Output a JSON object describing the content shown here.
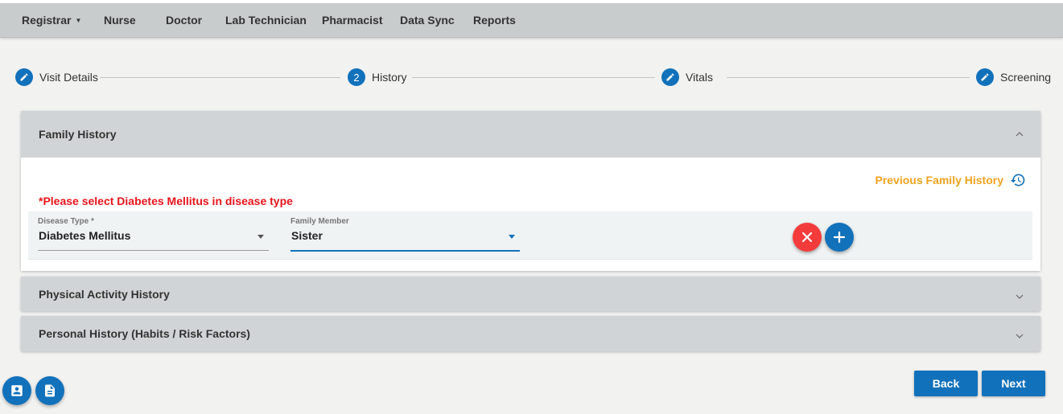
{
  "nav": {
    "items": [
      {
        "label": "Registrar",
        "has_dropdown": true
      },
      {
        "label": "Nurse"
      },
      {
        "label": "Doctor"
      },
      {
        "label": "Lab Technician"
      },
      {
        "label": "Pharmacist"
      },
      {
        "label": "Data Sync"
      },
      {
        "label": "Reports"
      }
    ]
  },
  "stepper": {
    "steps": [
      {
        "label": "Visit Details",
        "icon": "pencil-icon",
        "state": "completed"
      },
      {
        "label": "History",
        "number": "2",
        "state": "active"
      },
      {
        "label": "Vitals",
        "icon": "pencil-icon",
        "state": "completed"
      },
      {
        "label": "Screening",
        "icon": "pencil-icon",
        "state": "completed"
      }
    ]
  },
  "family_history": {
    "title": "Family History",
    "expanded": true,
    "previous_link": "Previous Family History",
    "error": "*Please select Diabetes Mellitus in disease type",
    "fields": {
      "disease_type": {
        "label": "Disease Type *",
        "value": "Diabetes Mellitus"
      },
      "family_member": {
        "label": "Family Member",
        "value": "Sister"
      }
    }
  },
  "physical_activity": {
    "title": "Physical Activity History",
    "expanded": false
  },
  "personal_history": {
    "title": "Personal History (Habits / Risk Factors)",
    "expanded": false
  },
  "actions": {
    "back_label": "Back",
    "next_label": "Next"
  },
  "colors": {
    "primary": "#1271bb",
    "error": "#e8141b",
    "link_orange": "#f0a21f",
    "remove_red": "#f43b3b",
    "header_gray": "#c8cccd"
  }
}
